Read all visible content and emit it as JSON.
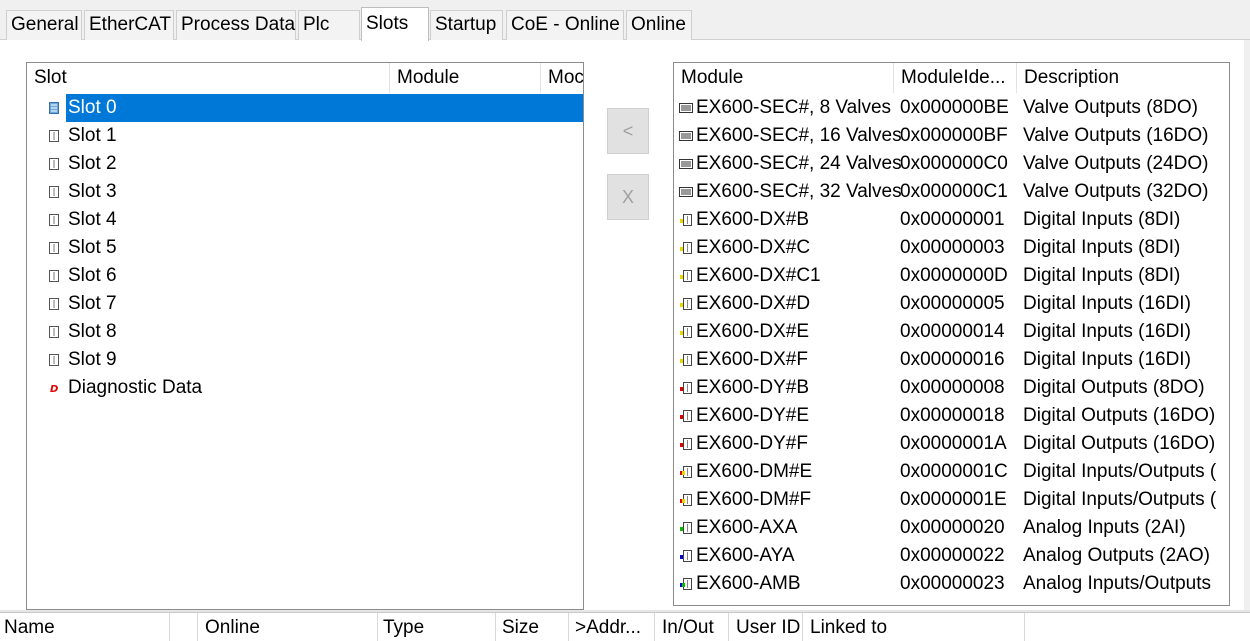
{
  "tabs": [
    "General",
    "EtherCAT",
    "Process Data",
    "Plc",
    "Slots",
    "Startup",
    "CoE - Online",
    "Online"
  ],
  "active_tab": "Slots",
  "slot_panel": {
    "headers": [
      "Slot",
      "Module",
      "Moc"
    ],
    "rows": [
      "Slot 0",
      "Slot 1",
      "Slot 2",
      "Slot 3",
      "Slot 4",
      "Slot 5",
      "Slot 6",
      "Slot 7",
      "Slot 8",
      "Slot 9",
      "Diagnostic Data"
    ],
    "selected": "Slot 0"
  },
  "buttons": {
    "insert_label": "<",
    "remove_label": "X"
  },
  "module_panel": {
    "headers": [
      "Module",
      "ModuleIde...",
      "Description"
    ],
    "rows": [
      {
        "module": "EX600-SEC#, 8 Valves",
        "id": "0x000000BE",
        "desc": "Valve Outputs (8DO)",
        "icon": "valve-icon"
      },
      {
        "module": "EX600-SEC#, 16 Valves",
        "id": "0x000000BF",
        "desc": "Valve Outputs (16DO)",
        "icon": "valve-icon"
      },
      {
        "module": "EX600-SEC#, 24 Valves",
        "id": "0x000000C0",
        "desc": "Valve Outputs (24DO)",
        "icon": "valve-icon"
      },
      {
        "module": "EX600-SEC#, 32 Valves",
        "id": "0x000000C1",
        "desc": "Valve Outputs (32DO)",
        "icon": "valve-icon"
      },
      {
        "module": "EX600-DX#B",
        "id": "0x00000001",
        "desc": "Digital Inputs (8DI)",
        "icon": "digital-input-icon"
      },
      {
        "module": "EX600-DX#C",
        "id": "0x00000003",
        "desc": "Digital Inputs (8DI)",
        "icon": "digital-input-icon"
      },
      {
        "module": "EX600-DX#C1",
        "id": "0x0000000D",
        "desc": "Digital Inputs (8DI)",
        "icon": "digital-input-icon"
      },
      {
        "module": "EX600-DX#D",
        "id": "0x00000005",
        "desc": "Digital Inputs (16DI)",
        "icon": "digital-input-icon"
      },
      {
        "module": "EX600-DX#E",
        "id": "0x00000014",
        "desc": "Digital Inputs (16DI)",
        "icon": "digital-input-icon"
      },
      {
        "module": "EX600-DX#F",
        "id": "0x00000016",
        "desc": "Digital Inputs (16DI)",
        "icon": "digital-input-icon"
      },
      {
        "module": "EX600-DY#B",
        "id": "0x00000008",
        "desc": "Digital Outputs (8DO)",
        "icon": "digital-output-icon"
      },
      {
        "module": "EX600-DY#E",
        "id": "0x00000018",
        "desc": "Digital Outputs (16DO)",
        "icon": "digital-output-icon"
      },
      {
        "module": "EX600-DY#F",
        "id": "0x0000001A",
        "desc": "Digital Outputs (16DO)",
        "icon": "digital-output-icon"
      },
      {
        "module": "EX600-DM#E",
        "id": "0x0000001C",
        "desc": "Digital Inputs/Outputs (",
        "icon": "digital-io-icon"
      },
      {
        "module": "EX600-DM#F",
        "id": "0x0000001E",
        "desc": "Digital Inputs/Outputs (",
        "icon": "digital-io-icon"
      },
      {
        "module": "EX600-AXA",
        "id": "0x00000020",
        "desc": "Analog Inputs (2AI)",
        "icon": "analog-input-icon"
      },
      {
        "module": "EX600-AYA",
        "id": "0x00000022",
        "desc": "Analog Outputs (2AO)",
        "icon": "analog-output-icon"
      },
      {
        "module": "EX600-AMB",
        "id": "0x00000023",
        "desc": "Analog Inputs/Outputs",
        "icon": "analog-io-icon"
      }
    ]
  },
  "bottom_grid": {
    "headers": [
      "Name",
      "",
      "Online",
      "Type",
      "Size",
      ">Addr...",
      "In/Out",
      "User ID",
      "Linked to"
    ]
  },
  "colors": {
    "selection": "#0078d7",
    "digital_input": "#e8d800",
    "digital_output": "#e00000",
    "analog_input": "#00c000",
    "analog_output": "#0000d0",
    "diagnostic": "#e00000"
  }
}
